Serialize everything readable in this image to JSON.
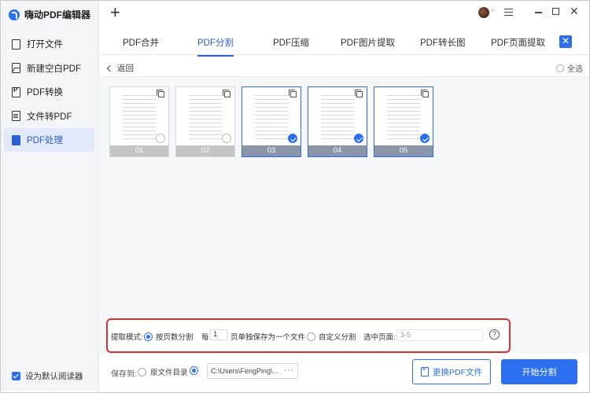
{
  "app": {
    "title": "嗨动PDF编辑器"
  },
  "sidebar": {
    "items": [
      {
        "label": "打开文件",
        "icon": "file-icon"
      },
      {
        "label": "新建空白PDF",
        "icon": "image-file-icon"
      },
      {
        "label": "PDF转换",
        "icon": "pdf-convert-icon"
      },
      {
        "label": "文件转PDF",
        "icon": "word-to-pdf-icon"
      },
      {
        "label": "PDF处理",
        "icon": "pdf-process-icon",
        "active": true
      }
    ],
    "default_reader_label": "设为默认阅读器"
  },
  "tabs": [
    {
      "label": "PDF合并"
    },
    {
      "label": "PDF分割",
      "active": true
    },
    {
      "label": "PDF压缩"
    },
    {
      "label": "PDF图片提取"
    },
    {
      "label": "PDF转长图"
    },
    {
      "label": "PDF页面提取"
    }
  ],
  "toolbar": {
    "back_label": "返回",
    "select_all_label": "全选"
  },
  "thumbnails": [
    {
      "num": "01",
      "selected": false
    },
    {
      "num": "02",
      "selected": false
    },
    {
      "num": "03",
      "selected": true
    },
    {
      "num": "04",
      "selected": true
    },
    {
      "num": "05",
      "selected": true
    }
  ],
  "options": {
    "mode_label": "提取模式:",
    "by_pages_label": "按页数分割",
    "every_label": "每",
    "every_value": "1",
    "save_each_label": "页单独保存为一个文件",
    "custom_label": "自定义分割",
    "selected_pages_label": "选中页面:",
    "selected_pages_value": "3-5",
    "help_symbol": "?"
  },
  "bottom": {
    "save_to_label": "保存到:",
    "original_dir_label": "原文件目录",
    "path_value": "C:\\Users\\FengPing\\...",
    "path_more": "···",
    "change_file_label": "更换PDF文件",
    "start_label": "开始分割"
  },
  "colors": {
    "accent": "#2b6ff0",
    "highlight_border": "#d9322a"
  }
}
